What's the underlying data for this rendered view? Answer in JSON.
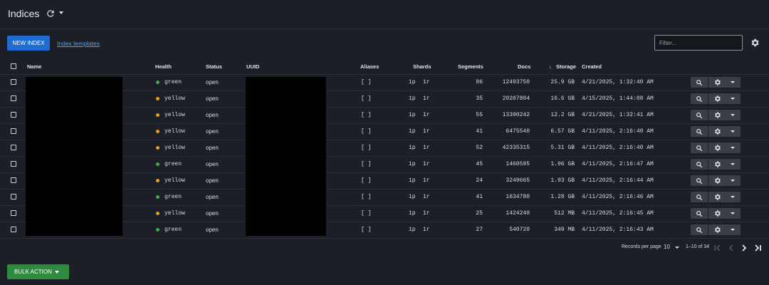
{
  "header": {
    "title": "Indices",
    "refresh_icon": "refresh-icon",
    "menu_icon": "chevron-down-icon"
  },
  "toolbar": {
    "new_index_label": "NEW INDEX",
    "templates_link": "Index templates",
    "filter_placeholder": "Filter...",
    "settings_icon": "gear-icon"
  },
  "columns": {
    "name": "Name",
    "health": "Health",
    "status": "Status",
    "uuid": "UUID",
    "aliases": "Aliases",
    "shards": "Shards",
    "segments": "Segments",
    "docs": "Docs",
    "storage": "Storage",
    "storage_sort": "↓",
    "created": "Created"
  },
  "colors": {
    "green": "#3fae49",
    "yellow": "#e5a01c",
    "primary": "#1f6bd1",
    "success": "#2e8b3e"
  },
  "rows": [
    {
      "health": "green",
      "status": "open",
      "aliases": "[ ]",
      "shards_p": "1p",
      "shards_r": "1r",
      "segments": "86",
      "docs": "12493750",
      "storage": "25.9 GB",
      "created": "4/21/2025, 1:32:40 AM"
    },
    {
      "health": "yellow",
      "status": "open",
      "aliases": "[ ]",
      "shards_p": "1p",
      "shards_r": "1r",
      "segments": "35",
      "docs": "20207804",
      "storage": "16.6 GB",
      "created": "4/15/2025, 1:44:08 AM"
    },
    {
      "health": "yellow",
      "status": "open",
      "aliases": "[ ]",
      "shards_p": "1p",
      "shards_r": "1r",
      "segments": "55",
      "docs": "13390242",
      "storage": "12.2 GB",
      "created": "4/21/2025, 1:32:41 AM"
    },
    {
      "health": "yellow",
      "status": "open",
      "aliases": "[ ]",
      "shards_p": "1p",
      "shards_r": "1r",
      "segments": "41",
      "docs": "6475540",
      "storage": "6.57 GB",
      "created": "4/11/2025, 2:16:40 AM"
    },
    {
      "health": "yellow",
      "status": "open",
      "aliases": "[ ]",
      "shards_p": "1p",
      "shards_r": "1r",
      "segments": "52",
      "docs": "42335315",
      "storage": "5.31 GB",
      "created": "4/11/2025, 2:16:40 AM"
    },
    {
      "health": "green",
      "status": "open",
      "aliases": "[ ]",
      "shards_p": "1p",
      "shards_r": "1r",
      "segments": "45",
      "docs": "1460595",
      "storage": "1.96 GB",
      "created": "4/11/2025, 2:16:47 AM"
    },
    {
      "health": "yellow",
      "status": "open",
      "aliases": "[ ]",
      "shards_p": "1p",
      "shards_r": "1r",
      "segments": "24",
      "docs": "3249665",
      "storage": "1.93 GB",
      "created": "4/11/2025, 2:16:44 AM"
    },
    {
      "health": "green",
      "status": "open",
      "aliases": "[ ]",
      "shards_p": "1p",
      "shards_r": "1r",
      "segments": "41",
      "docs": "1634780",
      "storage": "1.28 GB",
      "created": "4/11/2025, 2:16:46 AM"
    },
    {
      "health": "yellow",
      "status": "open",
      "aliases": "[ ]",
      "shards_p": "1p",
      "shards_r": "1r",
      "segments": "25",
      "docs": "1424240",
      "storage": "512 MB",
      "created": "4/11/2025, 2:16:45 AM"
    },
    {
      "health": "green",
      "status": "open",
      "aliases": "[ ]",
      "shards_p": "1p",
      "shards_r": "1r",
      "segments": "27",
      "docs": "540720",
      "storage": "349 MB",
      "created": "4/11/2025, 2:16:43 AM"
    }
  ],
  "row_actions": {
    "search_icon": "search-icon",
    "gear_icon": "gear-icon",
    "menu_icon": "chevron-down-icon"
  },
  "pagination": {
    "records_label": "Records per page",
    "per_page": "10",
    "range": "1–10 of 34",
    "first_icon": "first-page-icon",
    "prev_icon": "prev-page-icon",
    "next_icon": "next-page-icon",
    "last_icon": "last-page-icon"
  },
  "footer": {
    "bulk_action_label": "BULK ACTION"
  }
}
